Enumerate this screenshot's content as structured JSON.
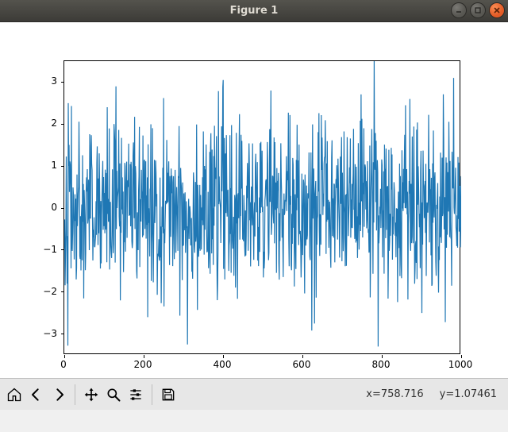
{
  "window": {
    "title": "Figure 1",
    "controls": {
      "minimize": "minimize-icon",
      "maximize": "maximize-icon",
      "close": "close-icon"
    }
  },
  "toolbar": {
    "items": [
      {
        "name": "home-icon",
        "label": "Home"
      },
      {
        "name": "back-icon",
        "label": "Back"
      },
      {
        "name": "forward-icon",
        "label": "Forward"
      },
      {
        "name": "pan-icon",
        "label": "Pan"
      },
      {
        "name": "zoom-icon",
        "label": "Zoom"
      },
      {
        "name": "configure-icon",
        "label": "Configure subplots"
      },
      {
        "name": "save-icon",
        "label": "Save"
      }
    ]
  },
  "status": {
    "x_label": "x=758.716",
    "y_label": "y=1.07461"
  },
  "chart_data": {
    "type": "line",
    "title": "",
    "xlabel": "",
    "ylabel": "",
    "xlim": [
      0,
      1000
    ],
    "ylim": [
      -3.5,
      3.5
    ],
    "xticks": [
      0,
      200,
      400,
      600,
      800,
      1000
    ],
    "yticks": [
      -3,
      -2,
      -1,
      0,
      1,
      2,
      3
    ],
    "series": [
      {
        "name": "series-0",
        "color": "#1f77b4",
        "description": "Dense noisy signal, 1000 samples of roughly standard normal distribution (mean≈0, std≈1)",
        "n_points": 1000,
        "stats": {
          "min": -3.3,
          "max": 3.6,
          "mean": 0.0,
          "std": 1.0
        },
        "values": []
      }
    ]
  }
}
